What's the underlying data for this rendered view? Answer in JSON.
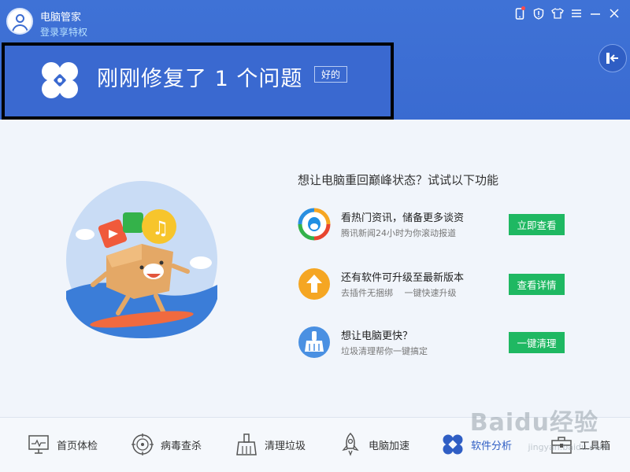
{
  "app": {
    "name": "电脑管家",
    "login_link": "登录享特权"
  },
  "banner": {
    "title": "刚刚修复了 1 个问题",
    "ok_button": "好的"
  },
  "promo": {
    "title": "想让电脑重回巅峰状态？试试以下功能",
    "features": [
      {
        "title": "看热门资讯，储备更多谈资",
        "subtitle": "腾讯新闻24小时为你滚动报道",
        "button": "立即查看",
        "icon": "tencent-news-icon",
        "color": "#1a8fe3"
      },
      {
        "title": "还有软件可升级至最新版本",
        "subtitle": "去插件无捆绑　 一键快速升级",
        "button": "查看详情",
        "icon": "upgrade-arrow-icon",
        "color": "#f5a623"
      },
      {
        "title": "想让电脑更快？",
        "subtitle": "垃圾清理帮你一键搞定",
        "button": "一键清理",
        "icon": "broom-icon",
        "color": "#4a90e2"
      }
    ]
  },
  "nav": [
    {
      "label": "首页体检",
      "icon": "monitor-icon",
      "active": false
    },
    {
      "label": "病毒查杀",
      "icon": "target-icon",
      "active": false
    },
    {
      "label": "清理垃圾",
      "icon": "broom-icon",
      "active": false
    },
    {
      "label": "电脑加速",
      "icon": "rocket-icon",
      "active": false
    },
    {
      "label": "软件分析",
      "icon": "fan-icon",
      "active": true
    },
    {
      "label": "工具箱",
      "icon": "toolbox-icon",
      "active": false
    }
  ],
  "watermark": {
    "logo_text": "Baidu经验",
    "url": "jingyan.baidu.com"
  },
  "colors": {
    "header_blue": "#3a6bd1",
    "button_green": "#1fb862",
    "accent_blue": "#2f5ec4"
  }
}
